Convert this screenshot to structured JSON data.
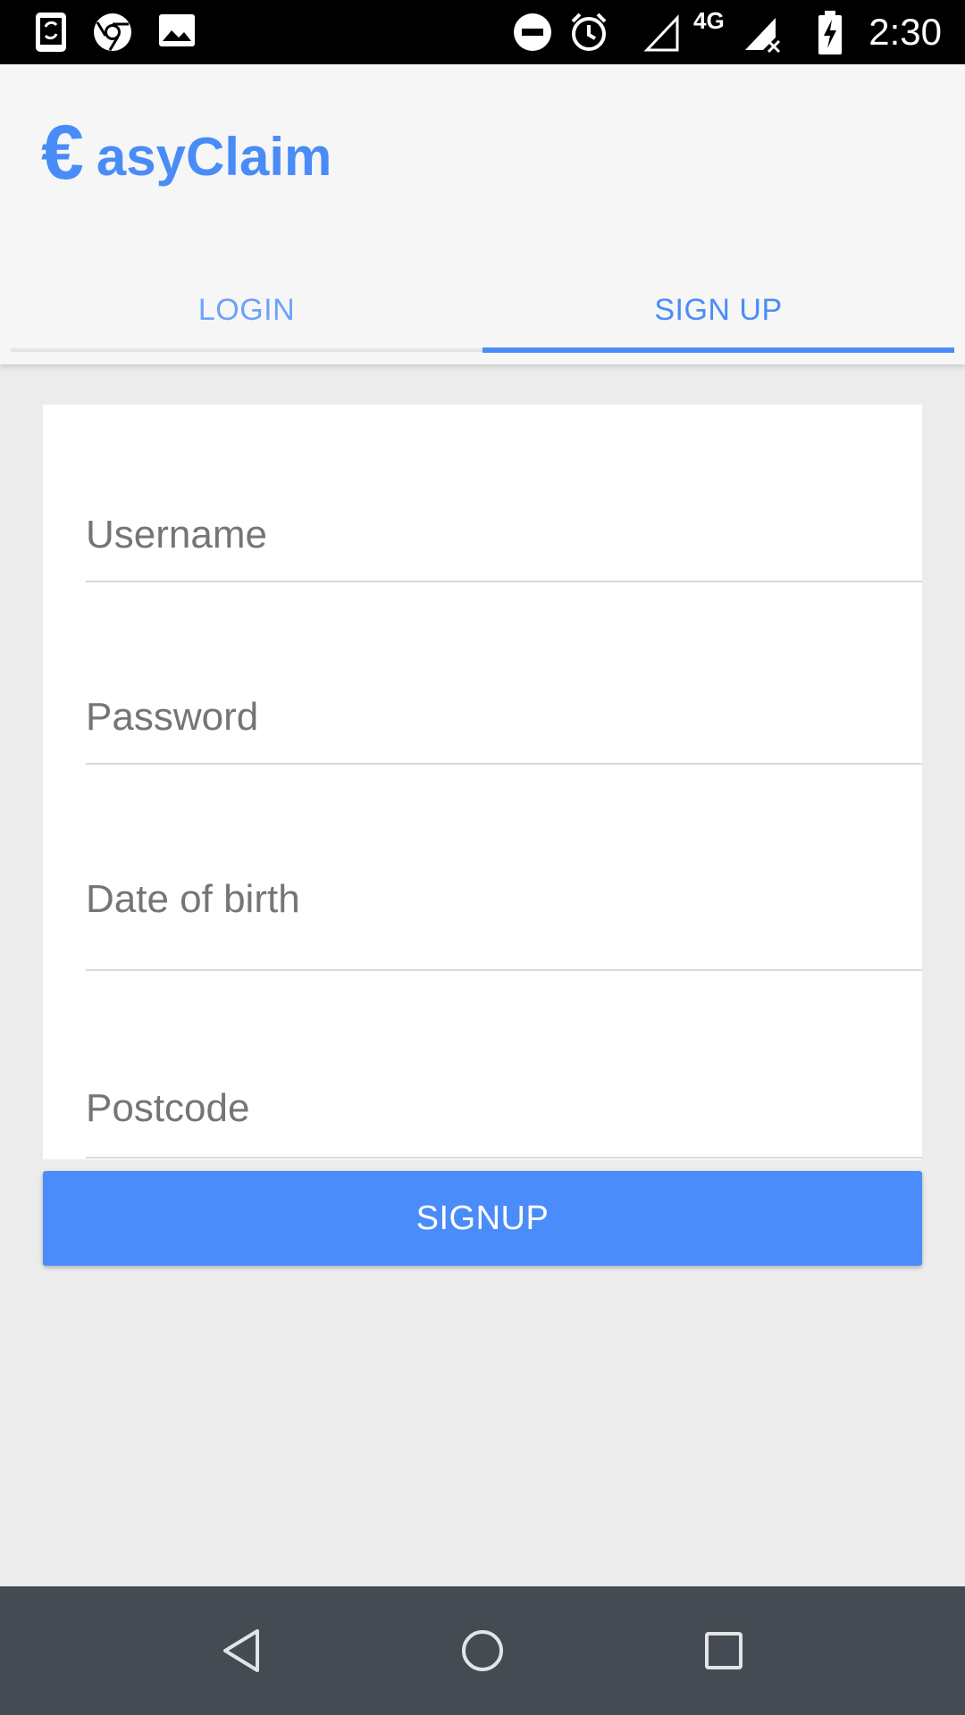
{
  "status_bar": {
    "time": "2:30",
    "network_label": "4G",
    "icons": [
      "phone-sync-icon",
      "chrome-icon",
      "image-icon",
      "dnd-icon",
      "alarm-icon",
      "signal-empty-icon",
      "signal-x-icon",
      "battery-charging-icon"
    ]
  },
  "app": {
    "logo_symbol": "€",
    "logo_text": "asyClaim",
    "brand_color": "#4a8cf7"
  },
  "tabs": [
    {
      "label": "LOGIN",
      "active": false
    },
    {
      "label": "SIGN UP",
      "active": true
    }
  ],
  "form": {
    "fields": [
      {
        "placeholder": "Username",
        "value": ""
      },
      {
        "placeholder": "Password",
        "value": ""
      },
      {
        "placeholder": "Date of birth",
        "value": ""
      },
      {
        "placeholder": "Postcode",
        "value": ""
      }
    ],
    "submit_label": "SIGNUP"
  },
  "nav_bar": {
    "buttons": [
      "back-icon",
      "home-icon",
      "recents-icon"
    ]
  }
}
